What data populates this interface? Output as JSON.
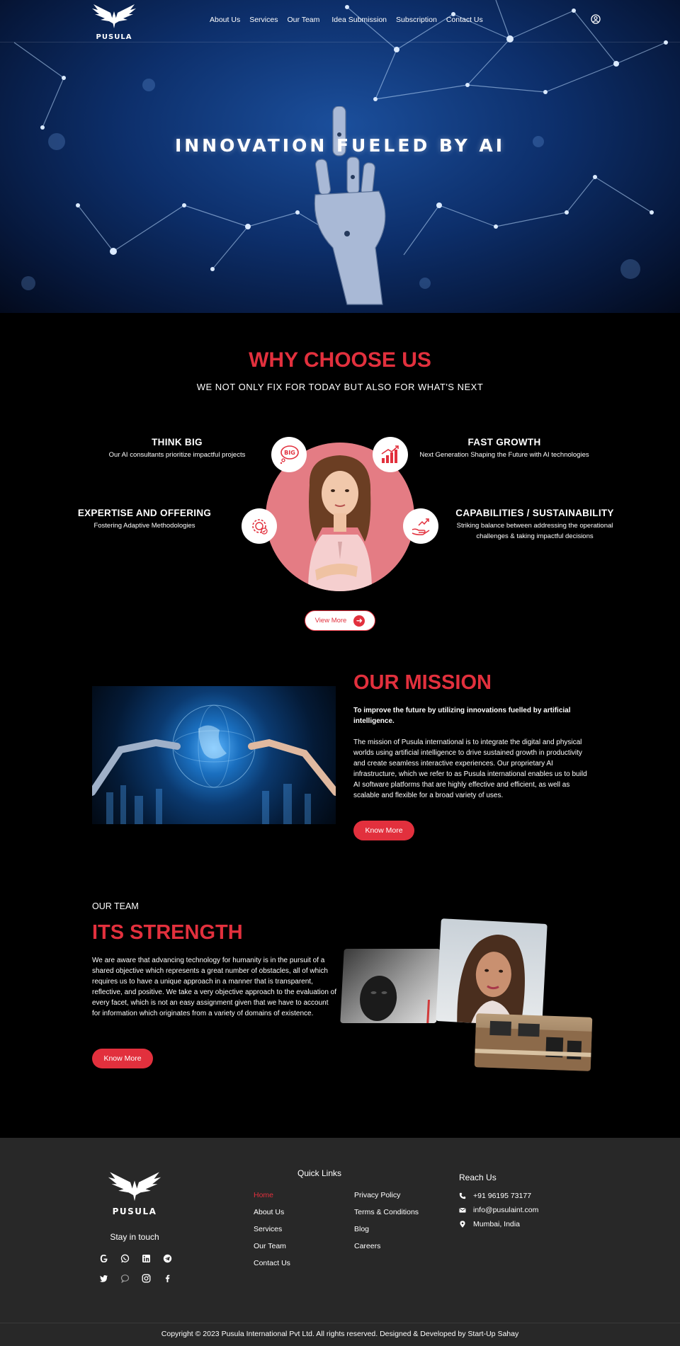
{
  "nav": {
    "brand": "PUSULA",
    "links": [
      "About Us",
      "Services",
      "Our Team",
      "Idea Submission",
      "Subscription",
      "Contact Us"
    ]
  },
  "hero": {
    "title": "INNOVATION FUELED BY AI"
  },
  "why": {
    "title": "WHY CHOOSE US",
    "subtitle": "WE NOT ONLY FIX FOR TODAY BUT ALSO FOR WHAT'S NEXT",
    "features": [
      {
        "title": "THINK BIG",
        "desc": "Our AI consultants prioritize impactful projects",
        "icon": "think-big-icon"
      },
      {
        "title": "FAST GROWTH",
        "desc": "Next Generation Shaping the Future with AI technologies",
        "icon": "growth-chart-icon"
      },
      {
        "title": "EXPERTISE AND OFFERING",
        "desc": "Fostering Adaptive Methodologies",
        "icon": "expertise-gear-icon"
      },
      {
        "title": "CAPABILITIES / SUSTAINABILITY",
        "desc": "Striking balance between addressing the operational challenges & taking impactful decisions",
        "icon": "hand-growth-icon"
      }
    ],
    "icon_badge_text": "BIG",
    "view_more": "View More"
  },
  "mission": {
    "title": "OUR MISSION",
    "lead": "To improve the future by utilizing innovations fuelled by artificial intelligence.",
    "body": "The mission of Pusula international is to integrate the digital and physical worlds using artificial intelligence to drive sustained growth in productivity and create seamless interactive experiences. Our proprietary AI infrastructure, which we refer to as Pusula international enables us to build AI software platforms that are highly effective and efficient, as well as scalable and flexible for a broad variety of uses.",
    "button": "Know More"
  },
  "team": {
    "eyebrow": "OUR TEAM",
    "title": "ITS STRENGTH",
    "body": "We are aware that advancing technology for humanity is in the pursuit of a shared objective which represents a great number of obstacles, all of which requires us to have a unique approach in a manner that is transparent, reflective, and positive. We take a very objective approach to the evaluation of every facet, which is not an easy assignment given that we have to account for information which originates from a variety of domains of existence.",
    "button": "Know More"
  },
  "footer": {
    "brand": "PUSULA",
    "stay_in_touch": "Stay in touch",
    "social_icons": [
      "google-icon",
      "whatsapp-icon",
      "linkedin-icon",
      "telegram-icon",
      "twitter-icon",
      "chat-icon",
      "instagram-icon",
      "facebook-icon"
    ],
    "quick_links_title": "Quick Links",
    "quick_links_col1": [
      "Home",
      "About Us",
      "Services",
      "Our Team",
      "Contact Us"
    ],
    "quick_links_col2": [
      "Privacy Policy",
      "Terms & Conditions",
      "Blog",
      "Careers"
    ],
    "reach_title": "Reach Us",
    "phone": "+91 96195 73177",
    "email": "info@pusulaint.com",
    "location": "Mumbai, India",
    "copyright": "Copyright © 2023 Pusula International Pvt Ltd. All rights reserved. Designed & Developed by Start-Up Sahay"
  },
  "colors": {
    "accent": "#e2303d",
    "footer_bg": "#282828",
    "circle": "#e47c84",
    "hero_blue": "#1b4f9c"
  }
}
